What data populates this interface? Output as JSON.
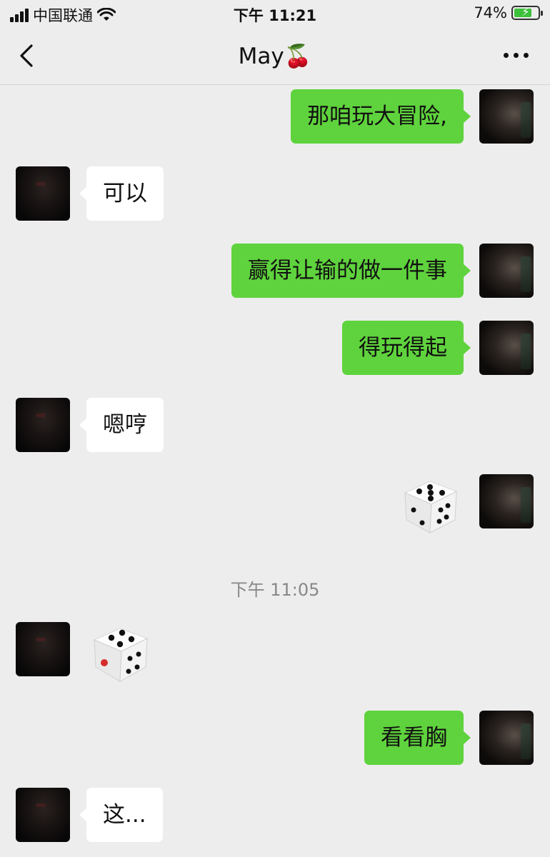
{
  "status_bar": {
    "carrier": "中国联通",
    "time": "下午 11:21",
    "battery_percent_label": "74%",
    "battery_level": 0.74
  },
  "nav": {
    "title": "May🍒",
    "back_icon": "chevron-left-icon",
    "more_icon": "ellipsis-icon"
  },
  "messages": [
    {
      "sender": "me",
      "text": "那咱玩大冒险,"
    },
    {
      "sender": "her",
      "text": "可以"
    },
    {
      "sender": "me",
      "text": "赢得让输的做一件事"
    },
    {
      "sender": "me",
      "text": "得玩得起"
    },
    {
      "sender": "her",
      "text": "嗯哼"
    },
    {
      "sender": "me",
      "type": "dice",
      "face": 5
    },
    {
      "sender": "her",
      "type": "dice",
      "face": 4
    },
    {
      "sender": "me",
      "text": "看看胸"
    },
    {
      "sender": "her",
      "text": "这..."
    }
  ],
  "timestamp": "下午 11:05",
  "colors": {
    "background": "#ededed",
    "my_bubble": "#5fd33d",
    "her_bubble": "#ffffff",
    "timestamp": "#888888"
  }
}
